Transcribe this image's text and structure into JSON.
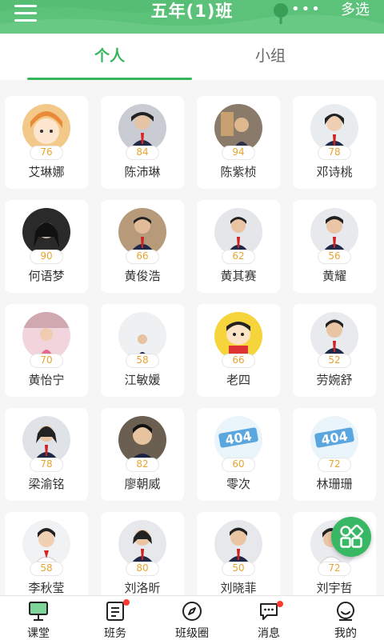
{
  "header": {
    "title": "五年(1)班",
    "more_icon": "more-dots-icon",
    "multi_select": "多选",
    "colors": {
      "header_bg": "#5cc27a",
      "accent": "#35b65c"
    }
  },
  "tabs": [
    {
      "label": "个人",
      "active": true
    },
    {
      "label": "小组",
      "active": false
    }
  ],
  "students": [
    {
      "name": "艾琳娜",
      "score": "76"
    },
    {
      "name": "陈沛琳",
      "score": "84"
    },
    {
      "name": "陈紫桢",
      "score": "94"
    },
    {
      "name": "邓诗桃",
      "score": "78"
    },
    {
      "name": "何语梦",
      "score": "90"
    },
    {
      "name": "黄俊浩",
      "score": "66"
    },
    {
      "name": "黄其赛",
      "score": "62"
    },
    {
      "name": "黄耀",
      "score": "56"
    },
    {
      "name": "黄怡宁",
      "score": "70"
    },
    {
      "name": "江敏媛",
      "score": "58"
    },
    {
      "name": "老四",
      "score": "66"
    },
    {
      "name": "劳婉舒",
      "score": "52"
    },
    {
      "name": "梁渝铭",
      "score": "78"
    },
    {
      "name": "廖朝威",
      "score": "82"
    },
    {
      "name": "零次",
      "score": "60"
    },
    {
      "name": "林珊珊",
      "score": "72"
    },
    {
      "name": "李秋莹",
      "score": "58"
    },
    {
      "name": "刘洛昕",
      "score": "80"
    },
    {
      "name": "刘晓菲",
      "score": "50"
    },
    {
      "name": "刘宇哲",
      "score": "72"
    }
  ],
  "bottom_nav": [
    {
      "label": "课堂",
      "icon": "classroom-icon",
      "active": true,
      "badge": false
    },
    {
      "label": "班务",
      "icon": "class-affairs-icon",
      "active": false,
      "badge": true
    },
    {
      "label": "班级圈",
      "icon": "compass-icon",
      "active": false,
      "badge": false
    },
    {
      "label": "消息",
      "icon": "message-icon",
      "active": false,
      "badge": true
    },
    {
      "label": "我的",
      "icon": "profile-icon",
      "active": false,
      "badge": false
    }
  ]
}
